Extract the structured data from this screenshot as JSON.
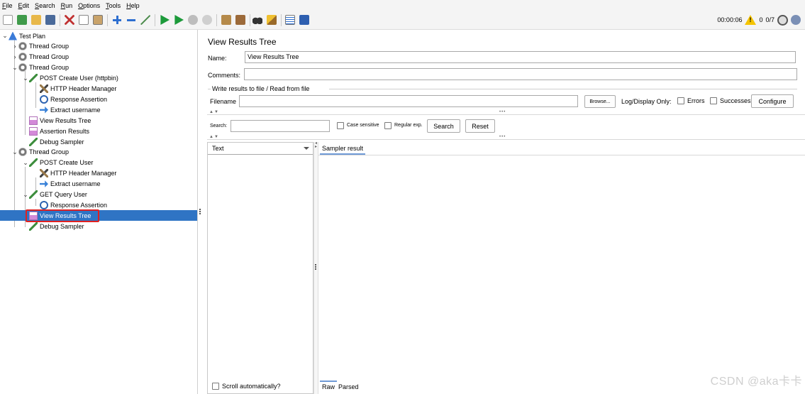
{
  "menu": [
    "File",
    "Edit",
    "Search",
    "Run",
    "Options",
    "Tools",
    "Help"
  ],
  "status": {
    "elapsed": "00:00:06",
    "warnings": "0",
    "threads": "0/7"
  },
  "tree": [
    {
      "label": "Test Plan",
      "icon": "test-plan-icon",
      "expander": "v"
    },
    {
      "label": "Thread Group",
      "icon": "thread-group-icon",
      "expander": ">"
    },
    {
      "label": "Thread Group",
      "icon": "thread-group-icon",
      "expander": ">"
    },
    {
      "label": "Thread Group",
      "icon": "thread-group-icon",
      "expander": "v"
    },
    {
      "label": "POST Create User (httpbin)",
      "icon": "http-sampler-icon",
      "expander": "v"
    },
    {
      "label": "HTTP Header Manager",
      "icon": "header-manager-icon",
      "expander": ""
    },
    {
      "label": "Response Assertion",
      "icon": "assertion-icon",
      "expander": ""
    },
    {
      "label": "Extract username",
      "icon": "extractor-icon",
      "expander": ""
    },
    {
      "label": "View Results Tree",
      "icon": "listener-icon",
      "expander": ""
    },
    {
      "label": "Assertion Results",
      "icon": "listener-icon",
      "expander": ""
    },
    {
      "label": "Debug Sampler",
      "icon": "http-sampler-icon",
      "expander": ""
    },
    {
      "label": "Thread Group",
      "icon": "thread-group-icon",
      "expander": "v"
    },
    {
      "label": "POST Create User",
      "icon": "http-sampler-icon",
      "expander": "v"
    },
    {
      "label": "HTTP Header Manager",
      "icon": "header-manager-icon",
      "expander": ""
    },
    {
      "label": "Extract username",
      "icon": "extractor-icon",
      "expander": ""
    },
    {
      "label": "GET Query User",
      "icon": "http-sampler-icon",
      "expander": "v"
    },
    {
      "label": "Response Assertion",
      "icon": "assertion-icon",
      "expander": ""
    },
    {
      "label": "View Results Tree",
      "icon": "listener-icon",
      "expander": "",
      "selected": true
    },
    {
      "label": "Debug Sampler",
      "icon": "http-sampler-icon",
      "expander": ""
    }
  ],
  "panel": {
    "title": "View Results Tree",
    "name_label": "Name:",
    "name_value": "View Results Tree",
    "comments_label": "Comments:",
    "comments_value": "",
    "file_group_label": "Write results to file / Read from file",
    "filename_label": "Filename",
    "filename_value": "",
    "browse_label": "Browse...",
    "log_display_label": "Log/Display Only:",
    "errors_label": "Errors",
    "successes_label": "Successes",
    "configure_label": "Configure",
    "search_label": "Search:",
    "search_value": "",
    "case_sensitive_label": "Case sensitive",
    "regex_label": "Regular exp.",
    "search_button": "Search",
    "reset_button": "Reset",
    "renderer_value": "Text",
    "sampler_result_tab": "Sampler result",
    "scroll_auto_label": "Scroll automatically?",
    "raw_tab": "Raw",
    "parsed_tab": "Parsed"
  },
  "watermark": "CSDN @aka卡卡"
}
